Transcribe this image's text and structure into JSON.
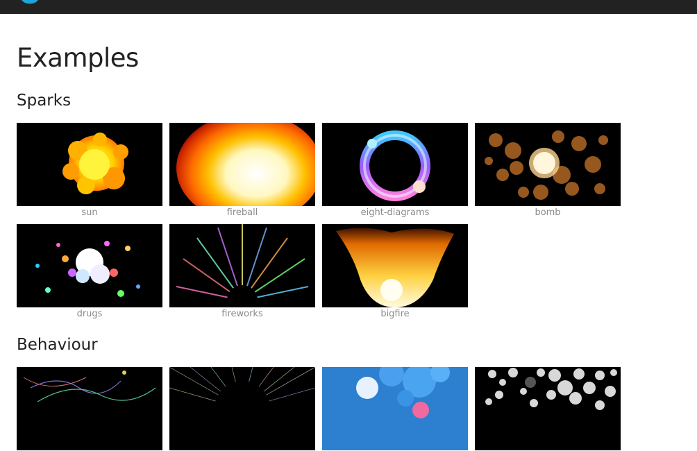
{
  "page": {
    "title": "Examples"
  },
  "sections": [
    {
      "title": "Sparks",
      "items": [
        {
          "label": "sun",
          "image": "yellow fiery sun blob"
        },
        {
          "label": "fireball",
          "image": "orange fireball glow"
        },
        {
          "label": "eight-diagrams",
          "image": "blue pink ring"
        },
        {
          "label": "bomb",
          "image": "orange bokeh explosion"
        },
        {
          "label": "drugs",
          "image": "colorful particle burst"
        },
        {
          "label": "fireworks",
          "image": "colorful streaks"
        },
        {
          "label": "bigfire",
          "image": "large flame"
        }
      ]
    },
    {
      "title": "Behaviour",
      "items": [
        {
          "label": "",
          "image": "thin colored trails on black"
        },
        {
          "label": "",
          "image": "radial lines burst"
        },
        {
          "label": "",
          "image": "blue bubbles"
        },
        {
          "label": "",
          "image": "grey spheres on black"
        }
      ]
    }
  ],
  "colors": {
    "topbar": "#222222",
    "logo": "#1fa3d8",
    "caption": "#8a8a8a"
  }
}
